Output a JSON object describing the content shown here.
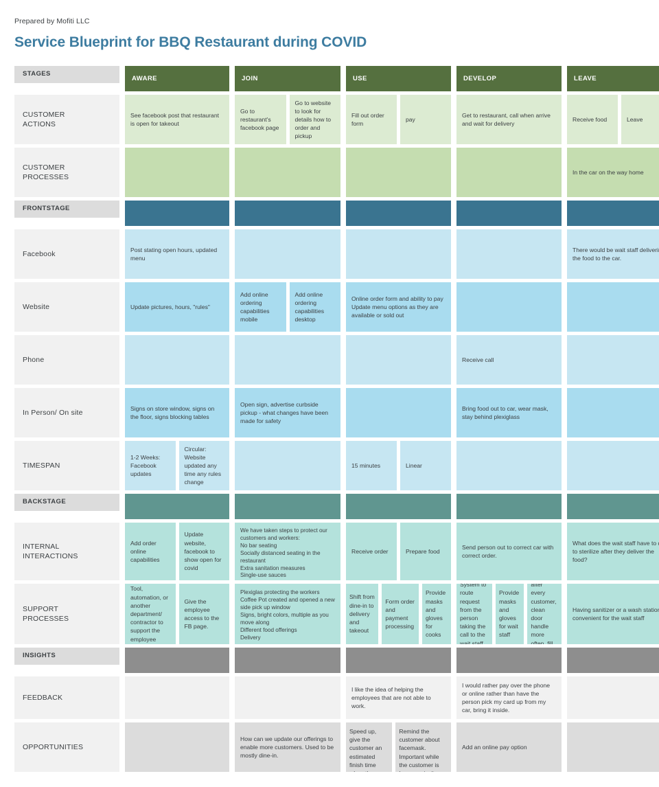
{
  "prepared_by": "Prepared by Mofiti LLC",
  "title": "Service Blueprint for BBQ Restaurant during COVID",
  "colors": {
    "title": "#3d7ca0",
    "stage_header": "#55703f",
    "frontstage_band": "#3a7490",
    "backstage_band": "#609690",
    "insights_band": "#8e8e8e",
    "customer_actions": "#dcebd2",
    "customer_processes": "#c5ddb0",
    "frontstage_pale": "#c6e6f2",
    "frontstage_mid": "#a9dcef",
    "backstage_cell": "#b4e2dc",
    "insights_cell": "#f1f1f1",
    "opportunities_cell": "#dcdcdc",
    "row_label": "#f1f1f1",
    "section_label": "#dcdcdc"
  },
  "stages_label": "STAGES",
  "stages": [
    "AWARE",
    "JOIN",
    "USE",
    "DEVELOP",
    "LEAVE"
  ],
  "rows": {
    "customer_actions": {
      "label": "CUSTOMER\nACTIONS",
      "aware": [
        "See facebook post that restaurant is open for takeout"
      ],
      "join": [
        "Go to restaurant's facebook page",
        "Go to website to look for details how to order and pickup"
      ],
      "use": [
        "Fill out order form",
        "pay"
      ],
      "develop": [
        "Get to restaurant, call when arrive and wait for delivery"
      ],
      "leave": [
        "Receive food",
        "Leave"
      ]
    },
    "customer_processes": {
      "label": "CUSTOMER\nPROCESSES",
      "aware": [
        ""
      ],
      "join": [
        ""
      ],
      "use": [
        ""
      ],
      "develop": [
        ""
      ],
      "leave": [
        "In the car on the way home"
      ]
    },
    "frontstage_band": {
      "label": "FRONTSTAGE"
    },
    "facebook": {
      "label": "Facebook",
      "aware": [
        "Post stating open hours, updated menu"
      ],
      "join": [
        ""
      ],
      "use": [
        ""
      ],
      "develop": [
        ""
      ],
      "leave": [
        "There would be wait staff delivering the food to the car."
      ]
    },
    "website": {
      "label": "Website",
      "aware": [
        "Update pictures, hours, \"rules\""
      ],
      "join": [
        "Add online ordering capabilities mobile",
        "Add online ordering capabilities desktop"
      ],
      "use": [
        "Online order form and ability to pay\nUpdate menu options as they are available or sold out"
      ],
      "develop": [
        ""
      ],
      "leave": [
        ""
      ]
    },
    "phone": {
      "label": "Phone",
      "aware": [
        ""
      ],
      "join": [
        ""
      ],
      "use": [
        ""
      ],
      "develop": [
        "Receive call"
      ],
      "leave": [
        ""
      ]
    },
    "in_person": {
      "label": "In Person/ On site",
      "aware": [
        "Signs on store window, signs on the floor, signs blocking tables"
      ],
      "join": [
        "Open sign, advertise curbside pickup - what changes have been made for safety"
      ],
      "use": [
        ""
      ],
      "develop": [
        "Bring food out to car, wear mask, stay behind plexiglass"
      ],
      "leave": [
        ""
      ]
    },
    "timespan": {
      "label": "TIMESPAN",
      "aware": [
        "1-2 Weeks: Facebook updates",
        "Circular: Website updated any time any rules change"
      ],
      "join": [
        ""
      ],
      "use": [
        "15 minutes",
        "Linear"
      ],
      "develop": [
        ""
      ],
      "leave": [
        ""
      ]
    },
    "backstage_band": {
      "label": "BACKSTAGE"
    },
    "internal_interactions": {
      "label": "INTERNAL\nINTERACTIONS",
      "aware": [
        "Add order online capabilities",
        "Update website, facebook to show open for covid"
      ],
      "join": [
        "We have taken steps to protect our customers and workers:\nNo bar seating\nSocially distanced seating in the restaurant\nExtra sanitation measures\nSingle-use sauces\nPre-wrapped silverware\nSingle-use menus"
      ],
      "use": [
        "Receive order",
        "Prepare food"
      ],
      "develop": [
        "Send person out to correct car with correct order."
      ],
      "leave": [
        "What does the wait staff have to do to sterilize after they deliver the food?"
      ]
    },
    "support_processes": {
      "label": "SUPPORT\nPROCESSES",
      "aware": [
        "Tool, automation, or another department/ contractor to support the employee",
        "Give the employee access to the FB page."
      ],
      "join": [
        "Plexiglas protecting the workers\nCoffee Pot created and opened a new side pick up window\nSigns, bright colors, multiple as you move along\nDifferent food offerings\nDelivery"
      ],
      "use": [
        "Shift from dine-in to delivery and takeout",
        "Form order and payment processing",
        "Provide masks and gloves for cooks"
      ],
      "develop": [
        "System to route request from the person taking the call to the wait staff",
        "Provide masks and gloves for wait staff",
        "Clean after every customer, clean door handle more often, fill sanitizer"
      ],
      "leave": [
        "Having sanitizer or a wash station convenient for the wait staff"
      ]
    },
    "insights_band": {
      "label": "INSIGHTS"
    },
    "feedback": {
      "label": "FEEDBACK",
      "aware": [
        ""
      ],
      "join": [
        ""
      ],
      "use": [
        "I like the idea of helping the employees that are not able to work."
      ],
      "develop": [
        "I would rather pay over the phone or online rather than have the person pick my card up from my car, bring it inside."
      ],
      "leave": [
        ""
      ]
    },
    "opportunities": {
      "label": "OPPORTUNITIES",
      "aware": [
        ""
      ],
      "join": [
        "How can we update our offerings to enable more customers. Used to be mostly dine-in."
      ],
      "use": [
        "Speed up, give the customer an estimated finish time when they order, etc.",
        " Remind the customer about facemask. Important  while the customer is home, or isn't driving."
      ],
      "develop": [
        "Add an online pay option"
      ],
      "leave": [
        ""
      ]
    }
  }
}
